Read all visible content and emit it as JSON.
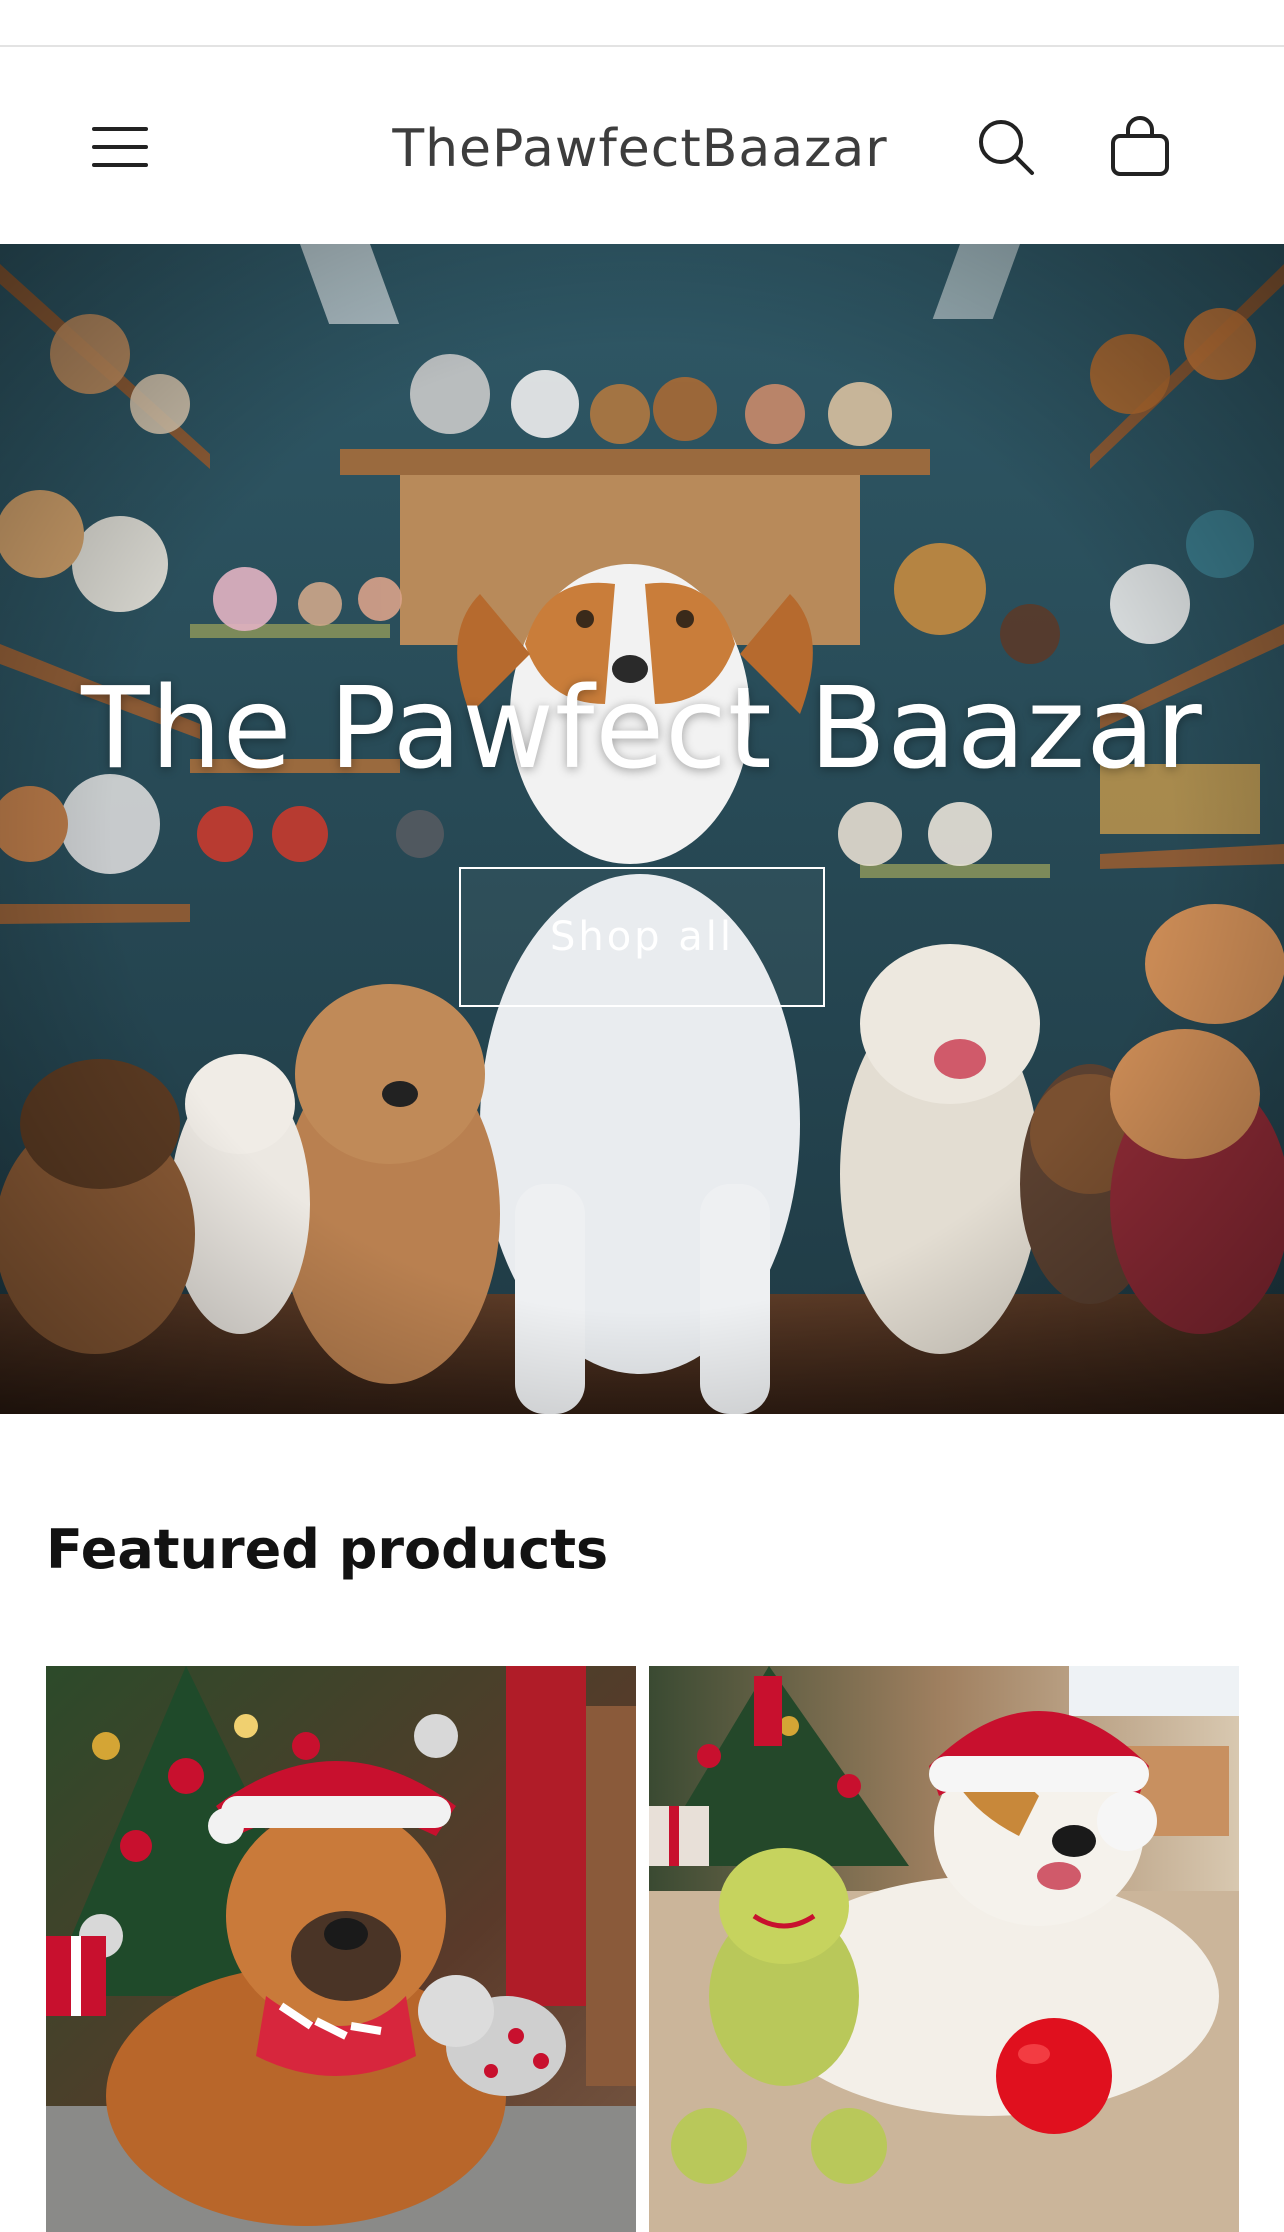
{
  "header": {
    "store_name": "ThePawfectBaazar",
    "menu_icon": "hamburger-menu-icon",
    "search_icon": "search-icon",
    "cart_icon": "shopping-bag-icon"
  },
  "hero": {
    "title": "The Pawfect Baazar",
    "button_label": "Shop all"
  },
  "featured": {
    "heading": "Featured products",
    "products": [
      {
        "image": "dog-in-santa-hat-with-plush-toy"
      },
      {
        "image": "dog-in-santa-hat-with-green-toy-and-red-ball"
      }
    ]
  },
  "colors": {
    "text_primary": "#121212",
    "header_text": "#3d3d3d",
    "hero_text": "#ffffff",
    "santa_red": "#c8102e"
  }
}
